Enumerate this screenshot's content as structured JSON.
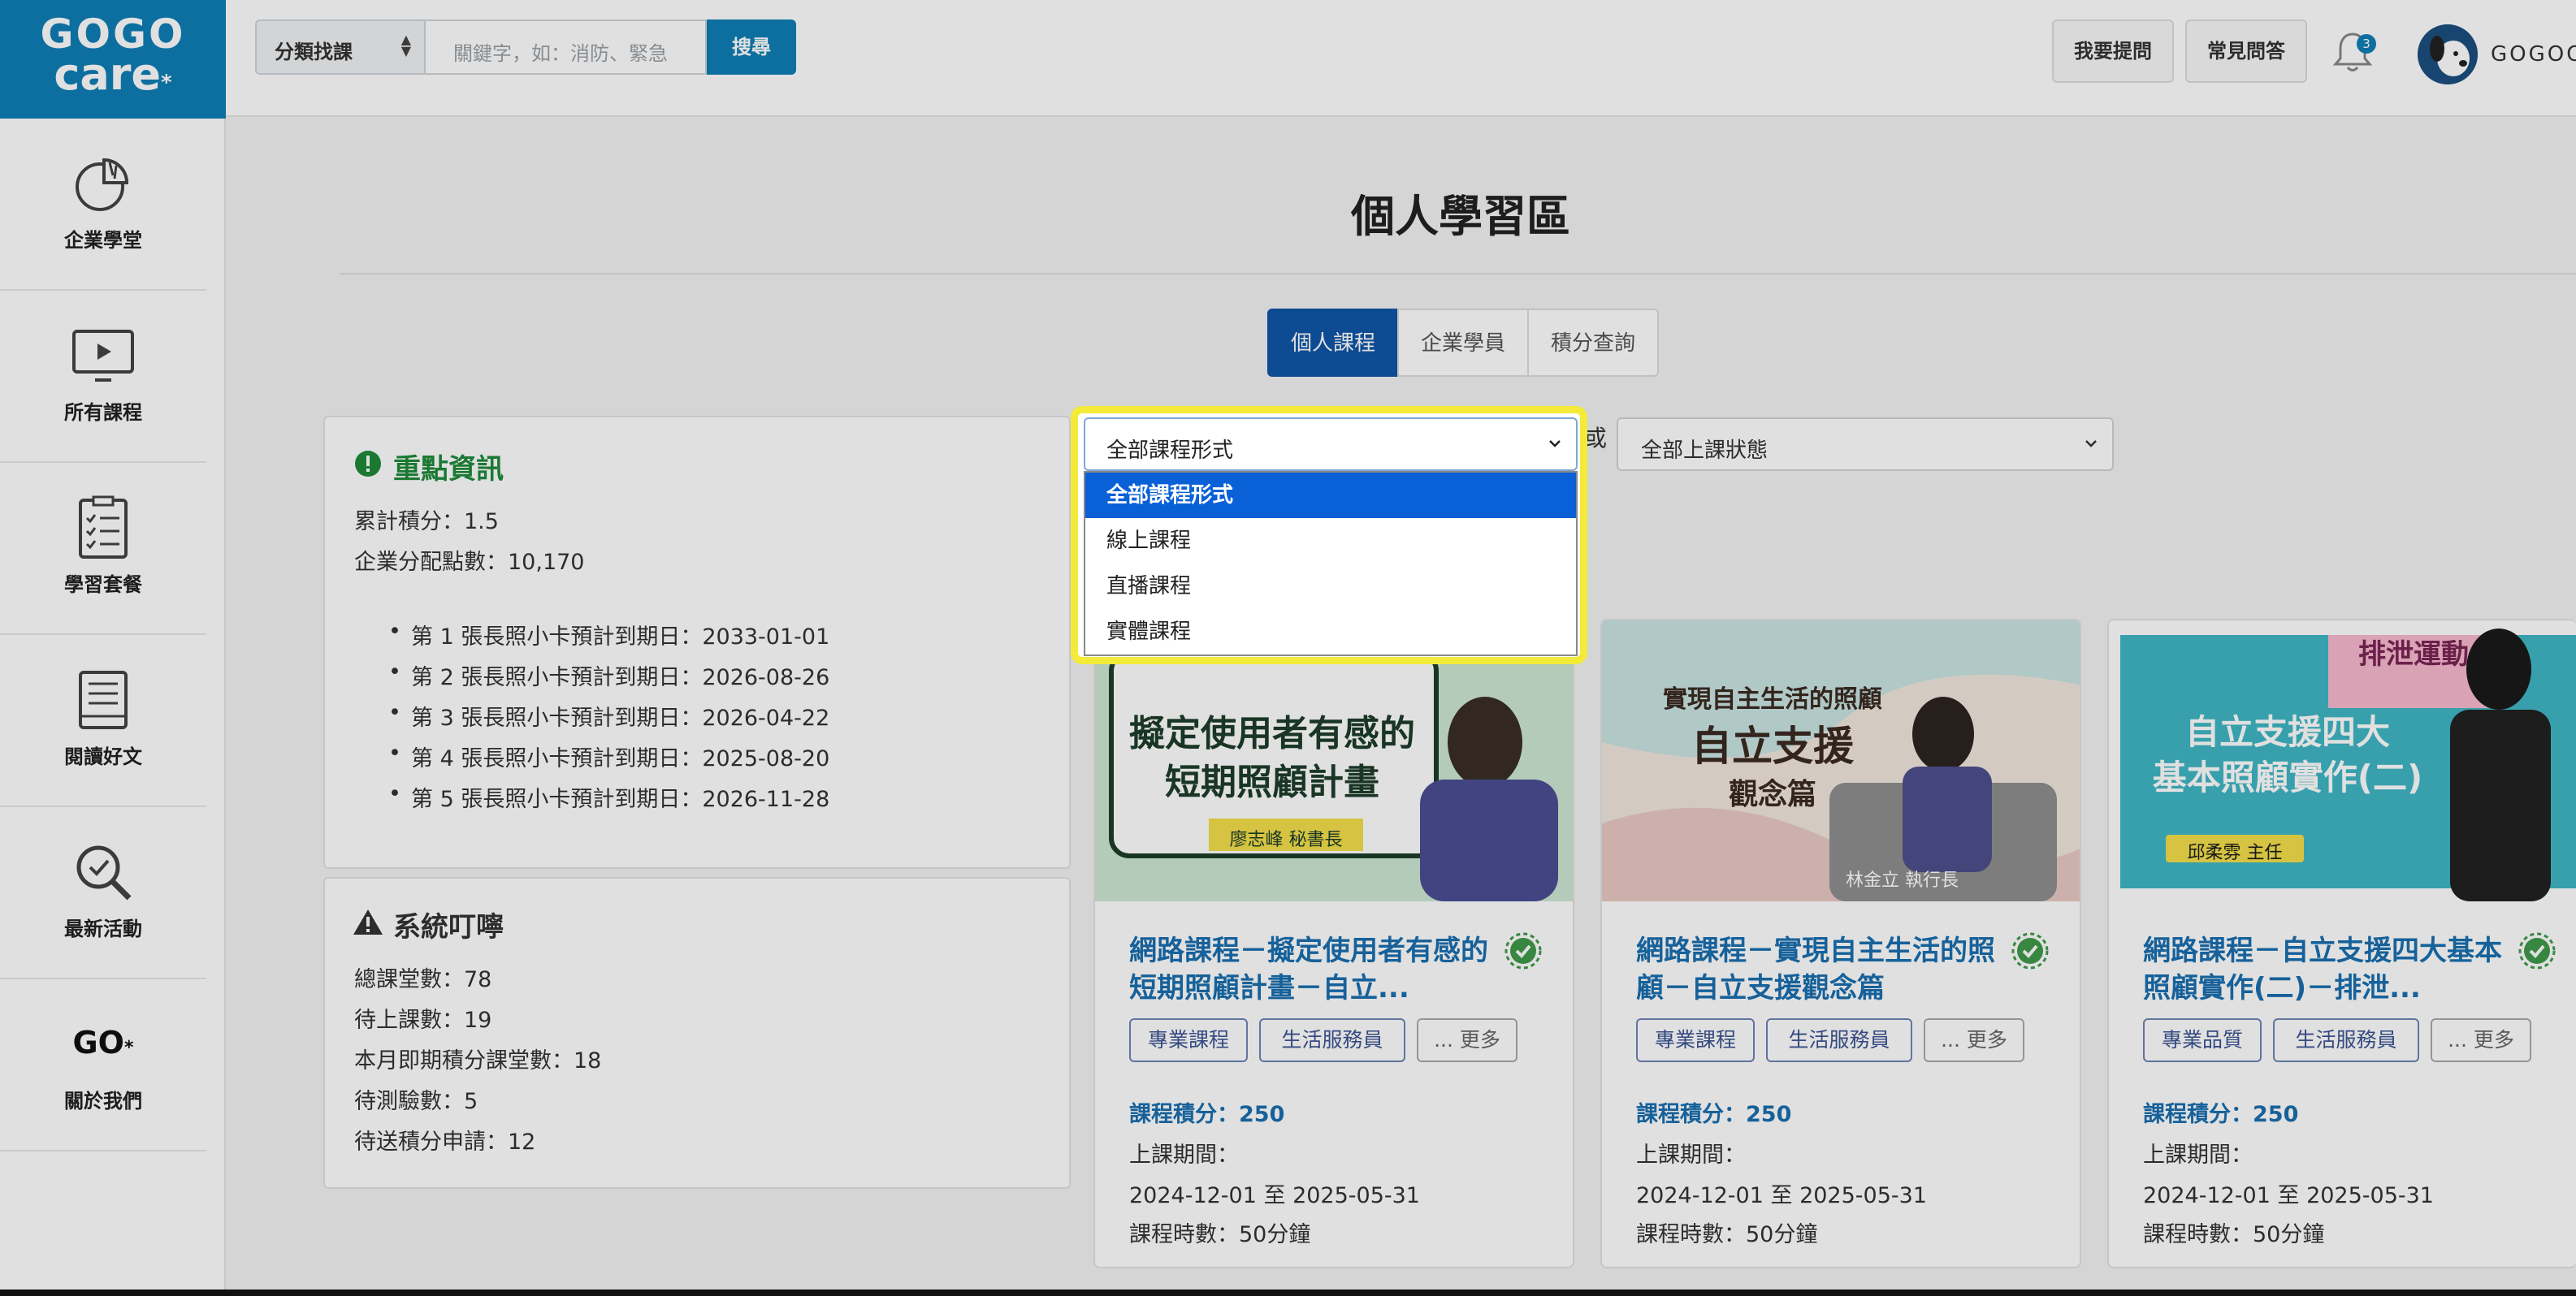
{
  "logo": {
    "line1": "GOGO",
    "line2": "care"
  },
  "header": {
    "category_select": "分類找課",
    "search_placeholder": "關鍵字，如：消防、緊急",
    "search_button": "搜尋",
    "ask_button": "我要提問",
    "faq_button": "常見問答",
    "notification_count": "3",
    "username": "GOGOCARE"
  },
  "sidebar": {
    "items": [
      {
        "label": "企業學堂"
      },
      {
        "label": "所有課程"
      },
      {
        "label": "學習套餐"
      },
      {
        "label": "閱讀好文"
      },
      {
        "label": "最新活動"
      },
      {
        "label": "關於我們",
        "icon_text": "GO"
      }
    ]
  },
  "main": {
    "page_title": "個人學習區",
    "tabs": [
      {
        "label": "個人課程",
        "active": true
      },
      {
        "label": "企業學員",
        "active": false
      },
      {
        "label": "積分查詢",
        "active": false
      }
    ]
  },
  "key_info": {
    "title": "重點資訊",
    "accumulated_points": "累計積分：1.5",
    "company_points": "企業分配點數：10,170",
    "cards": [
      "第 1 張長照小卡預計到期日：2033-01-01",
      "第 2 張長照小卡預計到期日：2026-08-26",
      "第 3 張長照小卡預計到期日：2026-04-22",
      "第 4 張長照小卡預計到期日：2025-08-20",
      "第 5 張長照小卡預計到期日：2026-11-28"
    ]
  },
  "system_notice": {
    "title": "系統叮嚀",
    "lines": [
      "總課堂數：78",
      "待上課數：19",
      "本月即期積分課堂數：18",
      "待測驗數：5",
      "待送積分申請：12"
    ]
  },
  "filters": {
    "format_select": "全部課程形式",
    "format_options": [
      "全部課程形式",
      "線上課程",
      "直播課程",
      "實體課程"
    ],
    "selected_index": 0,
    "connector": "或",
    "status_select": "全部上課狀態"
  },
  "courses": [
    {
      "title": "網路課程－擬定使用者有感的短期照顧計畫－自立...",
      "image_title": [
        "擬定使用者有感的",
        "短期照顧計畫"
      ],
      "image_presenter": "廖志峰 秘書長",
      "tags": [
        "專業課程",
        "生活服務員",
        "... 更多"
      ],
      "credit": "課程積分：250",
      "period_label": "上課期間：",
      "period": "2024-12-01 至 2025-05-31",
      "duration": "課程時數：50分鐘"
    },
    {
      "title": "網路課程－實現自主生活的照顧－自立支援觀念篇",
      "image_title": [
        "實現自主生活的照顧",
        "自立支援",
        "觀念篇"
      ],
      "image_presenter": "林金立 執行長",
      "tags": [
        "專業課程",
        "生活服務員",
        "... 更多"
      ],
      "credit": "課程積分：250",
      "period_label": "上課期間：",
      "period": "2024-12-01 至 2025-05-31",
      "duration": "課程時數：50分鐘"
    },
    {
      "title": "網路課程－自立支援四大基本照顧實作(二)－排泄...",
      "image_title": [
        "自立支援四大",
        "基本照顧實作(二)"
      ],
      "image_badge": "排泄運動",
      "image_presenter": "邱柔雰 主任",
      "tags": [
        "專業品質",
        "生活服務員",
        "... 更多"
      ],
      "credit": "課程積分：250",
      "period_label": "上課期間：",
      "period": "2024-12-01 至 2025-05-31",
      "duration": "課程時數：50分鐘"
    }
  ],
  "colors": {
    "brand": "#0f7fb5",
    "active_tab": "#0f56a8",
    "highlight": "#f3ea3a",
    "option_selected": "#0a60d6",
    "course_title": "#1a6fb0"
  }
}
